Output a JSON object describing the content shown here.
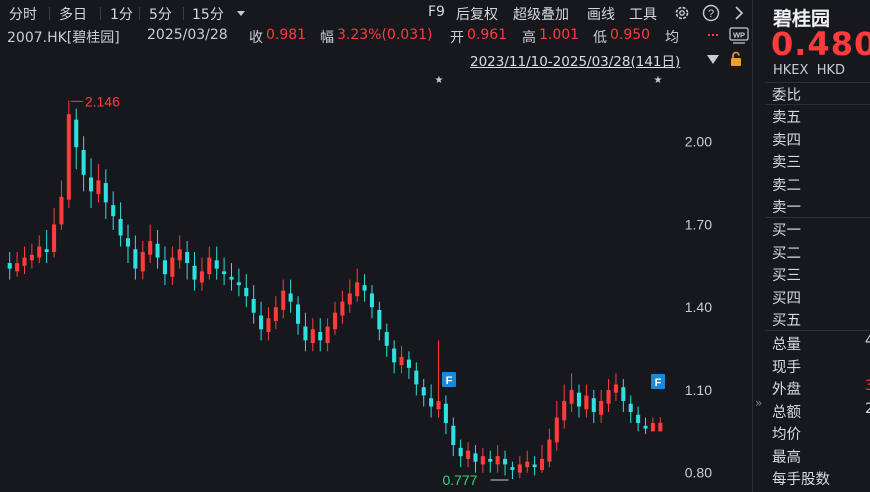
{
  "toolbar": {
    "tabs": [
      "分时",
      "多日",
      "1分",
      "5分",
      "15分"
    ],
    "dropdown_icon": "caret-down-icon",
    "right_items": [
      "F9",
      "后复权",
      "超级叠加",
      "画线",
      "工具"
    ],
    "icons": [
      "gear-icon",
      "help-icon",
      "chevron-right-icon"
    ]
  },
  "info": {
    "code": "2007.HK[碧桂园]",
    "date": "2025/03/28",
    "close_label": "收",
    "close_value": "0.981",
    "change_label": "幅",
    "change_value": "3.23%(0.031)",
    "open_label": "开",
    "open_value": "0.961",
    "high_label": "高",
    "high_value": "1.001",
    "low_label": "低",
    "low_value": "0.950",
    "avg_label": "均",
    "range_text": "2023/11/10-2025/03/28(141日)",
    "range_icon": "triangle-down-icon",
    "lock_icon": "lock-icon",
    "wp_icon": "wp-icon"
  },
  "right_panel": {
    "name": "碧桂园",
    "price": "0.480",
    "exchange": "HKEX",
    "currency": "HKD",
    "weibi_label": "委比",
    "ask_labels": [
      "卖五",
      "卖四",
      "卖三",
      "卖二",
      "卖一"
    ],
    "bid_labels": [
      "买一",
      "买二",
      "买三",
      "买四",
      "买五"
    ],
    "stats": [
      {
        "label": "总量",
        "value": "4"
      },
      {
        "label": "现手",
        "value": ""
      },
      {
        "label": "外盘",
        "value": "3"
      },
      {
        "label": "总额",
        "value": "2"
      },
      {
        "label": "均价",
        "value": ""
      },
      {
        "label": "最高",
        "value": ""
      },
      {
        "label": "每手股数",
        "value": ""
      }
    ],
    "collapse_icon": "double-chevron-right-icon"
  },
  "chart_data": {
    "type": "candlestick",
    "y_ticks": [
      2.0,
      1.7,
      1.4,
      1.1,
      0.8
    ],
    "y_tick_labels": [
      "2.00",
      "1.70",
      "1.40",
      "1.10",
      "0.80"
    ],
    "ylim": [
      0.73,
      2.26
    ],
    "max_label": "2.146",
    "min_label": "0.777",
    "up_color": "#ff3b3b",
    "down_color": "#2ee0e0",
    "markers": [
      "F",
      "F"
    ],
    "stars": [
      "★",
      "★"
    ],
    "candles": [
      [
        1.56,
        1.54,
        1.6,
        1.5
      ],
      [
        1.53,
        1.56,
        1.6,
        1.51
      ],
      [
        1.55,
        1.58,
        1.62,
        1.52
      ],
      [
        1.57,
        1.59,
        1.63,
        1.54
      ],
      [
        1.58,
        1.62,
        1.66,
        1.56
      ],
      [
        1.61,
        1.6,
        1.68,
        1.56
      ],
      [
        1.6,
        1.7,
        1.76,
        1.58
      ],
      [
        1.7,
        1.8,
        1.86,
        1.68
      ],
      [
        1.79,
        2.1,
        2.15,
        1.76
      ],
      [
        2.08,
        1.98,
        2.12,
        1.9
      ],
      [
        1.97,
        1.88,
        2.02,
        1.82
      ],
      [
        1.87,
        1.82,
        1.94,
        1.76
      ],
      [
        1.81,
        1.86,
        1.92,
        1.78
      ],
      [
        1.85,
        1.78,
        1.9,
        1.72
      ],
      [
        1.77,
        1.73,
        1.82,
        1.68
      ],
      [
        1.72,
        1.66,
        1.78,
        1.62
      ],
      [
        1.65,
        1.62,
        1.7,
        1.56
      ],
      [
        1.61,
        1.54,
        1.66,
        1.5
      ],
      [
        1.53,
        1.6,
        1.64,
        1.5
      ],
      [
        1.59,
        1.64,
        1.7,
        1.56
      ],
      [
        1.63,
        1.58,
        1.68,
        1.54
      ],
      [
        1.57,
        1.52,
        1.62,
        1.48
      ],
      [
        1.51,
        1.58,
        1.62,
        1.48
      ],
      [
        1.57,
        1.61,
        1.66,
        1.54
      ],
      [
        1.6,
        1.56,
        1.64,
        1.5
      ],
      [
        1.55,
        1.5,
        1.6,
        1.46
      ],
      [
        1.49,
        1.53,
        1.58,
        1.46
      ],
      [
        1.52,
        1.58,
        1.62,
        1.5
      ],
      [
        1.57,
        1.54,
        1.62,
        1.5
      ],
      [
        1.53,
        1.52,
        1.58,
        1.48
      ],
      [
        1.51,
        1.5,
        1.56,
        1.46
      ],
      [
        1.49,
        1.48,
        1.54,
        1.44
      ],
      [
        1.47,
        1.44,
        1.52,
        1.4
      ],
      [
        1.43,
        1.38,
        1.48,
        1.34
      ],
      [
        1.37,
        1.32,
        1.42,
        1.28
      ],
      [
        1.31,
        1.36,
        1.4,
        1.28
      ],
      [
        1.35,
        1.4,
        1.44,
        1.32
      ],
      [
        1.39,
        1.46,
        1.5,
        1.36
      ],
      [
        1.45,
        1.42,
        1.5,
        1.38
      ],
      [
        1.41,
        1.34,
        1.44,
        1.3
      ],
      [
        1.33,
        1.28,
        1.38,
        1.24
      ],
      [
        1.27,
        1.32,
        1.36,
        1.24
      ],
      [
        1.31,
        1.28,
        1.36,
        1.24
      ],
      [
        1.27,
        1.33,
        1.36,
        1.24
      ],
      [
        1.32,
        1.38,
        1.42,
        1.3
      ],
      [
        1.37,
        1.42,
        1.46,
        1.34
      ],
      [
        1.41,
        1.45,
        1.5,
        1.38
      ],
      [
        1.44,
        1.49,
        1.54,
        1.42
      ],
      [
        1.48,
        1.46,
        1.52,
        1.42
      ],
      [
        1.45,
        1.4,
        1.48,
        1.36
      ],
      [
        1.39,
        1.32,
        1.42,
        1.28
      ],
      [
        1.31,
        1.26,
        1.34,
        1.22
      ],
      [
        1.25,
        1.2,
        1.28,
        1.16
      ],
      [
        1.19,
        1.22,
        1.26,
        1.16
      ],
      [
        1.21,
        1.18,
        1.24,
        1.14
      ],
      [
        1.17,
        1.12,
        1.2,
        1.08
      ],
      [
        1.11,
        1.08,
        1.14,
        1.04
      ],
      [
        1.07,
        1.04,
        1.12,
        1.0
      ],
      [
        1.03,
        1.06,
        1.28,
        1.0
      ],
      [
        1.05,
        0.98,
        1.08,
        0.94
      ],
      [
        0.97,
        0.9,
        1.0,
        0.86
      ],
      [
        0.89,
        0.86,
        0.92,
        0.82
      ],
      [
        0.85,
        0.88,
        0.91,
        0.82
      ],
      [
        0.87,
        0.84,
        0.9,
        0.8
      ],
      [
        0.83,
        0.86,
        0.89,
        0.8
      ],
      [
        0.85,
        0.84,
        0.88,
        0.8
      ],
      [
        0.83,
        0.86,
        0.9,
        0.8
      ],
      [
        0.85,
        0.83,
        0.88,
        0.79
      ],
      [
        0.82,
        0.81,
        0.84,
        0.777
      ],
      [
        0.8,
        0.83,
        0.86,
        0.78
      ],
      [
        0.82,
        0.84,
        0.88,
        0.8
      ],
      [
        0.83,
        0.82,
        0.86,
        0.79
      ],
      [
        0.81,
        0.85,
        0.9,
        0.8
      ],
      [
        0.84,
        0.92,
        0.96,
        0.82
      ],
      [
        0.91,
        1.0,
        1.06,
        0.88
      ],
      [
        0.99,
        1.06,
        1.12,
        0.96
      ],
      [
        1.05,
        1.1,
        1.16,
        1.02
      ],
      [
        1.09,
        1.04,
        1.12,
        1.0
      ],
      [
        1.03,
        1.08,
        1.12,
        1.0
      ],
      [
        1.07,
        1.02,
        1.1,
        0.98
      ],
      [
        1.01,
        1.06,
        1.1,
        0.98
      ],
      [
        1.05,
        1.1,
        1.14,
        1.02
      ],
      [
        1.09,
        1.12,
        1.16,
        1.06
      ],
      [
        1.11,
        1.06,
        1.14,
        1.02
      ],
      [
        1.05,
        1.02,
        1.08,
        0.98
      ],
      [
        1.01,
        0.98,
        1.04,
        0.95
      ],
      [
        0.97,
        0.96,
        1.0,
        0.94
      ],
      [
        0.95,
        0.98,
        1.0,
        0.95
      ],
      [
        0.95,
        0.981,
        1.001,
        0.95
      ]
    ]
  }
}
